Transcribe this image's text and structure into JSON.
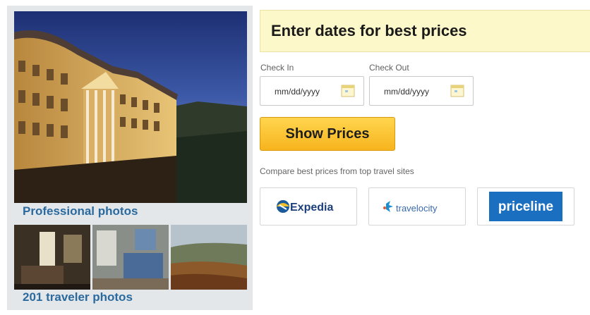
{
  "photos": {
    "professional_label": "Professional photos",
    "traveler_label": "201 traveler photos"
  },
  "booking": {
    "banner_title": "Enter dates for best prices",
    "check_in_label": "Check In",
    "check_out_label": "Check Out",
    "check_in_value": "mm/dd/yyyy",
    "check_out_value": "mm/dd/yyyy",
    "show_prices_label": "Show Prices",
    "compare_text": "Compare best prices from top travel sites"
  },
  "partners": {
    "expedia": "Expedia",
    "travelocity": "travelocity",
    "priceline": "priceline"
  },
  "colors": {
    "link": "#2a6a9e",
    "banner_bg": "#fdf8c9",
    "button": "#f7b41e",
    "priceline_blue": "#1a6fc0"
  }
}
